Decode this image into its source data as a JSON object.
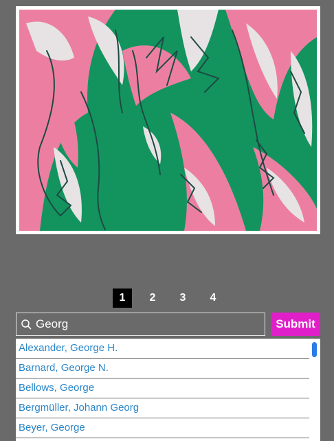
{
  "pagination": {
    "pages": [
      "1",
      "2",
      "3",
      "4"
    ],
    "current": "1"
  },
  "search": {
    "value": "Georg",
    "placeholder": "",
    "submit_label": "Submit"
  },
  "results": [
    "Alexander, George H.",
    "Barnard, George N.",
    "Bellows, George",
    "Bergmüller, Johann Georg",
    "Beyer, George"
  ],
  "colors": {
    "background": "#6a6a6a",
    "artwork_green": "#13945e",
    "artwork_pink": "#ec7fa1",
    "artwork_grey": "#e7e3e4",
    "submit": "#e11fc8",
    "link": "#2a86c8",
    "scroll_thumb": "#2a7de6"
  },
  "icons": {
    "search": "magnifier-icon"
  }
}
